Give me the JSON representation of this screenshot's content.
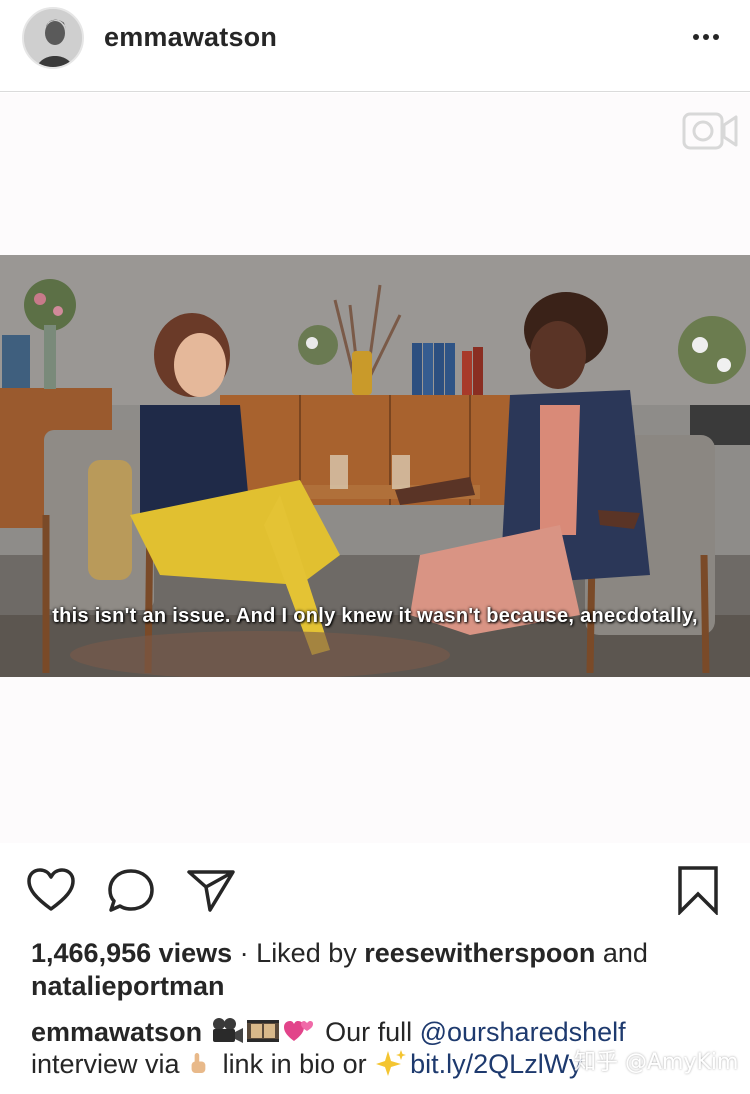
{
  "header": {
    "username": "emmawatson",
    "more_icon": "more-horizontal-icon"
  },
  "media": {
    "type_icon": "video-camera-icon",
    "subtitle": "this isn't an issue. And I only knew it wasn't because, anecdotally,"
  },
  "actions": {
    "like_icon": "heart-icon",
    "comment_icon": "comment-bubble-icon",
    "share_icon": "paper-plane-icon",
    "save_icon": "bookmark-icon"
  },
  "stats": {
    "views": "1,466,956 views",
    "separator": " · ",
    "liked_by_prefix": "Liked by ",
    "liked_user_1": "reesewitherspoon",
    "and_text": " and",
    "liked_user_2": "natalieportman"
  },
  "caption": {
    "username": "emmawatson",
    "emojis_1": [
      "video-camera-emoji",
      "film-frames-emoji",
      "revolving-hearts-emoji"
    ],
    "text_1": " Our full ",
    "mention": "@oursharedshelf",
    "text_2": "interview via ",
    "emoji_point": "pointing-up-emoji",
    "text_3": " link in bio or ",
    "emoji_sparkles": "sparkles-emoji",
    "link": "bit.ly/2QLzlWy"
  },
  "watermark": "知乎 @AmyKim"
}
